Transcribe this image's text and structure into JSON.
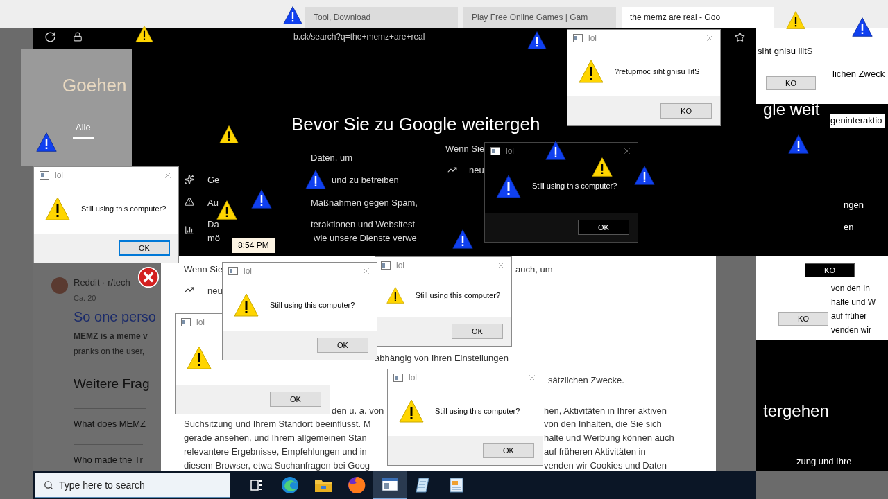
{
  "browser": {
    "tabs": [
      {
        "title": "Tool, Download",
        "selected": false
      },
      {
        "title": "Play Free Online Games | Gam",
        "selected": false
      },
      {
        "title": "the memz are real - Goo",
        "selected": true
      }
    ],
    "url": "b.ck/search?q=the+memz+are+real"
  },
  "consent_dark": {
    "heading": "Bevor Sie zu Google weitergeh",
    "lines": [
      "Daten, um",
      "und zu betreiben",
      "Maßnahmen gegen Spam,",
      "teraktionen und Websitest",
      "wie unsere Dienste verwe"
    ],
    "side_items": [
      "Wenn Sie",
      "neu",
      "Ge",
      "Au",
      "Da",
      "mö"
    ]
  },
  "search_panel": {
    "logo": "Goehen",
    "tab": "Alle"
  },
  "results": {
    "source": "Reddit · r/tech",
    "date": "Ca. 20",
    "title": "So one perso",
    "snippet_bold": "MEMZ is a meme v",
    "snippet": "pranks on the user,",
    "section": "Weitere Frag",
    "questions": [
      "What does MEMZ",
      "Who made the Tr"
    ]
  },
  "consent_light": {
    "fragments": [
      "Wenn Sie",
      "auch, um",
      "neu",
      "abhängig von Ihren Einstellungen",
      "sätzlichen Zwecke.",
      "den u. a. von",
      "hen, Aktivitäten in Ihrer aktiven",
      "Suchsitzung und Ihrem Standort beeinflusst. M",
      "gerade ansehen, und Ihrem allgemeinen Stan",
      "relevantere Ergebnisse, Empfehlungen und in",
      "diesem Browser, etwa Suchanfragen bei Goog",
      "von den Inhalten, die Sie sich",
      "halte und Werbung können auch",
      "auf früheren Aktivitäten in",
      "venden wir Cookies und Daten"
    ]
  },
  "right_side": {
    "fragments": [
      "siht gnisu llitS",
      "lichen Zweck",
      "geninteraktio",
      "gle weit",
      "ngen",
      "en",
      "von den In",
      "halte und W",
      "auf früher",
      "venden wir",
      "tergehen",
      "zung und Ihre"
    ],
    "buttons": [
      "KO",
      "KO",
      "KO"
    ]
  },
  "dialogs": [
    {
      "kind": "light",
      "title": "lol",
      "button": "OK",
      "focused": false
    },
    {
      "kind": "light",
      "title": "lol",
      "message": "Still using this computer?",
      "button": "OK",
      "focused": false
    },
    {
      "kind": "light",
      "title": "lol",
      "message": "Still using this computer?",
      "button": "OK",
      "focused": false
    },
    {
      "kind": "light",
      "title": "lol",
      "message": "Still using this computer?",
      "button": "OK",
      "focused": false
    },
    {
      "kind": "light",
      "title": "lol",
      "message": "Still using this computer?",
      "button": "OK",
      "focused": true
    },
    {
      "kind": "dark",
      "title": "lol",
      "message": "Still using this computer?",
      "button": "OK",
      "focused": false
    },
    {
      "kind": "light",
      "title": "lol",
      "message": "?retupmoc siht gnisu llitS",
      "button": "KO",
      "focused": false
    }
  ],
  "floating_icons": [
    {
      "kind": "info"
    },
    {
      "kind": "warning"
    },
    {
      "kind": "info"
    },
    {
      "kind": "info"
    },
    {
      "kind": "info"
    },
    {
      "kind": "warning"
    },
    {
      "kind": "info"
    },
    {
      "kind": "warning"
    },
    {
      "kind": "info"
    },
    {
      "kind": "warning"
    },
    {
      "kind": "info"
    },
    {
      "kind": "info"
    },
    {
      "kind": "warning"
    },
    {
      "kind": "info"
    },
    {
      "kind": "info"
    },
    {
      "kind": "error"
    }
  ],
  "clock": "8:54 PM",
  "taskbar": {
    "search_placeholder": "Type here to search",
    "apps": [
      {
        "kind": "taskview",
        "active": false
      },
      {
        "kind": "edge",
        "active": false
      },
      {
        "kind": "explorer",
        "active": false
      },
      {
        "kind": "firefox",
        "active": false
      },
      {
        "kind": "window",
        "active": true
      },
      {
        "kind": "notepad",
        "active": false
      },
      {
        "kind": "wordpad",
        "active": false
      }
    ]
  }
}
